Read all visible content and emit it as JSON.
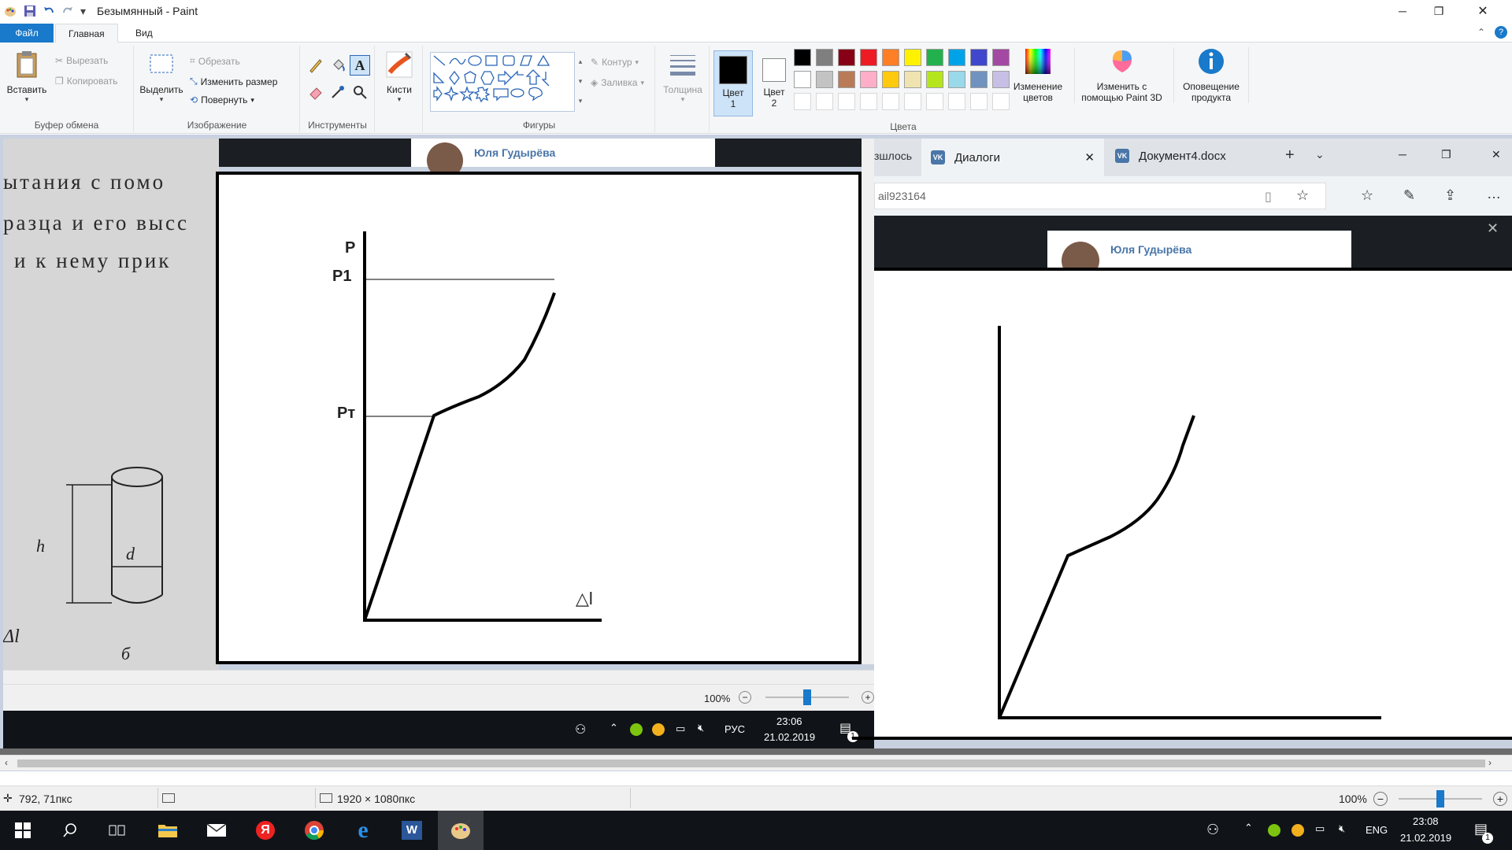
{
  "titlebar": {
    "title": "Безымянный - Paint",
    "minimize": "─",
    "maximize": "❐",
    "close": "✕"
  },
  "tabs": {
    "file": "Файл",
    "home": "Главная",
    "view": "Вид"
  },
  "ribbon": {
    "clipboard": {
      "paste": "Вставить",
      "cut": "Вырезать",
      "copy": "Копировать",
      "label": "Буфер обмена"
    },
    "image": {
      "select": "Выделить",
      "crop": "Обрезать",
      "resize": "Изменить размер",
      "rotate": "Повернуть",
      "label": "Изображение"
    },
    "tools": {
      "label": "Инструменты"
    },
    "brushes": {
      "label": "Кисти"
    },
    "shapes": {
      "outline": "Контур",
      "fill": "Заливка",
      "label": "Фигуры"
    },
    "thickness": {
      "label": "Толщина"
    },
    "color1": {
      "label1": "Цвет",
      "label2": "1"
    },
    "color2": {
      "label1": "Цвет",
      "label2": "2"
    },
    "colors": {
      "label": "Цвета"
    },
    "editcolors": {
      "label1": "Изменение",
      "label2": "цветов"
    },
    "paint3d": {
      "label1": "Изменить с",
      "label2": "помощью Paint 3D"
    },
    "notify": {
      "label1": "Оповещение",
      "label2": "продукта"
    }
  },
  "palette": {
    "row1": [
      "#000000",
      "#7f7f7f",
      "#880015",
      "#ed1c24",
      "#ff7f27",
      "#fff200",
      "#22b14c",
      "#00a2e8",
      "#3f48cc",
      "#a349a4"
    ],
    "row2": [
      "#ffffff",
      "#c3c3c3",
      "#b97a57",
      "#ffaec9",
      "#ffc90e",
      "#efe4b0",
      "#b5e61d",
      "#99d9ea",
      "#7092be",
      "#c8bfe7"
    ]
  },
  "left_inner": {
    "book_line1": "ытания с помо",
    "book_line2": "разца и его высс",
    "book_line3": "и к нему прик",
    "book_h": "h",
    "book_d": "d",
    "book_b": "б",
    "book_al": "Δl",
    "chat_name": "Юля Гудырёва",
    "graph_P": "P",
    "graph_P1": "P1",
    "graph_Pt": "Pт",
    "graph_dl": "△l",
    "zoom": "100%",
    "clock_time": "23:06",
    "clock_date": "21.02.2019",
    "lang": "РУС",
    "notif_count": "1"
  },
  "browser": {
    "tab_partial": "зшлось",
    "tab_active": "Диалоги",
    "tab_doc": "Документ4.docx",
    "address": "ail923164",
    "chat_name": "Юля Гудырёва"
  },
  "status": {
    "cursor_pos": "792, 71пкс",
    "canvas_size": "1920 × 1080пкс",
    "zoom": "100%"
  },
  "taskbar": {
    "lang": "ENG",
    "time": "23:08",
    "date": "21.02.2019",
    "notif": "1"
  },
  "colors": {
    "accent": "#1979ca",
    "vk_blue": "#4a76a8"
  }
}
